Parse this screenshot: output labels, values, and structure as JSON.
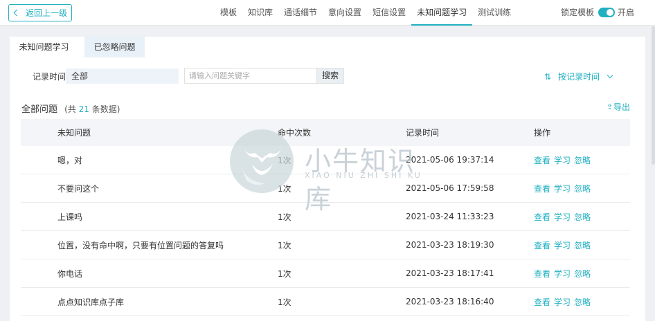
{
  "header": {
    "back_label": "返回上一级",
    "nav": [
      {
        "label": "模板"
      },
      {
        "label": "知识库"
      },
      {
        "label": "通话细节"
      },
      {
        "label": "意向设置"
      },
      {
        "label": "短信设置"
      },
      {
        "label": "未知问题学习",
        "active": true
      },
      {
        "label": "测试训练"
      }
    ],
    "lock_label": "锁定模板",
    "lock_state_label": "开启"
  },
  "tabs": [
    {
      "label": "未知问题学习",
      "active": true
    },
    {
      "label": "已忽略问题",
      "active": false
    }
  ],
  "filters": {
    "time_label": "记录时间",
    "time_value": "全部",
    "search_placeholder": "请输入问题关键字",
    "search_button": "搜索",
    "sort_label": "按记录时间"
  },
  "summary": {
    "title": "全部问题",
    "count_prefix": "(共",
    "count": "21",
    "count_suffix": "条数据)",
    "export_label": "导出"
  },
  "table": {
    "columns": [
      "未知问题",
      "命中次数",
      "记录时间",
      "操作"
    ],
    "rows": [
      {
        "question": "嗯，对",
        "hits": "1次",
        "time": "2021-05-06 19:37:14"
      },
      {
        "question": "不要问这个",
        "hits": "1次",
        "time": "2021-05-06 17:59:58"
      },
      {
        "question": "上课吗",
        "hits": "1次",
        "time": "2021-03-24 11:33:23"
      },
      {
        "question": "位置，没有命中啊，只要有位置问题的答复吗",
        "hits": "1次",
        "time": "2021-03-23 18:19:30"
      },
      {
        "question": "你电话",
        "hits": "1次",
        "time": "2021-03-23 18:17:41"
      },
      {
        "question": "点点知识库点子库",
        "hits": "1次",
        "time": "2021-03-23 18:16:40"
      }
    ],
    "actions": [
      "查看",
      "学习",
      "忽略"
    ]
  },
  "watermark": {
    "text": "小牛知识库",
    "sub": "XIAO NIU ZHI SHI KU"
  },
  "colors": {
    "accent": "#21b0c0",
    "background": "#eef0f3"
  }
}
